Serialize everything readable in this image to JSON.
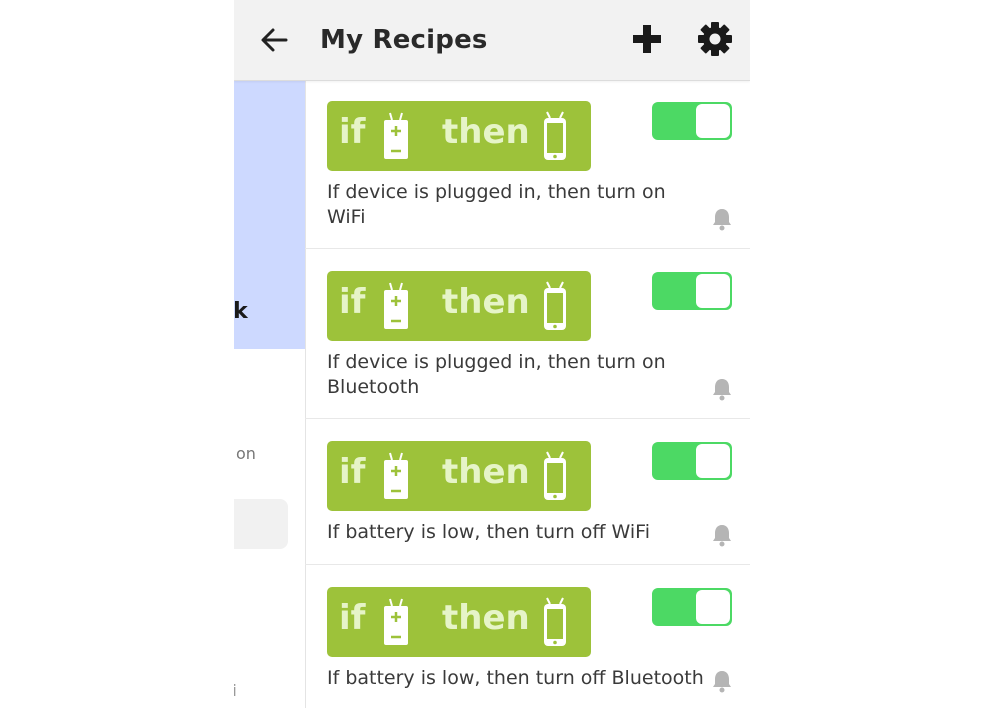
{
  "header": {
    "title": "My Recipes",
    "back_icon": "arrow-left-icon",
    "add_icon": "plus-icon",
    "settings_icon": "gear-icon"
  },
  "side_panel": {
    "bold_fragment": "ok",
    "text_fragment": "on",
    "bottom_fragment": "'i"
  },
  "banner": {
    "if_word": "if",
    "then_word": "then",
    "trigger_icon": "battery-charging-icon",
    "action_icon": "smartphone-icon",
    "color": "#9dc23a"
  },
  "recipes": [
    {
      "description": "If device is plugged in, then turn on WiFi",
      "enabled": true
    },
    {
      "description": "If device is plugged in, then turn on Bluetooth",
      "enabled": true
    },
    {
      "description": "If battery is low, then turn off WiFi",
      "enabled": true
    },
    {
      "description": "If battery is low, then turn off Bluetooth",
      "enabled": true
    }
  ],
  "colors": {
    "toggle_on": "#4cd964",
    "header_bg": "#f2f2f2",
    "side_accent": "#cdd9ff"
  }
}
